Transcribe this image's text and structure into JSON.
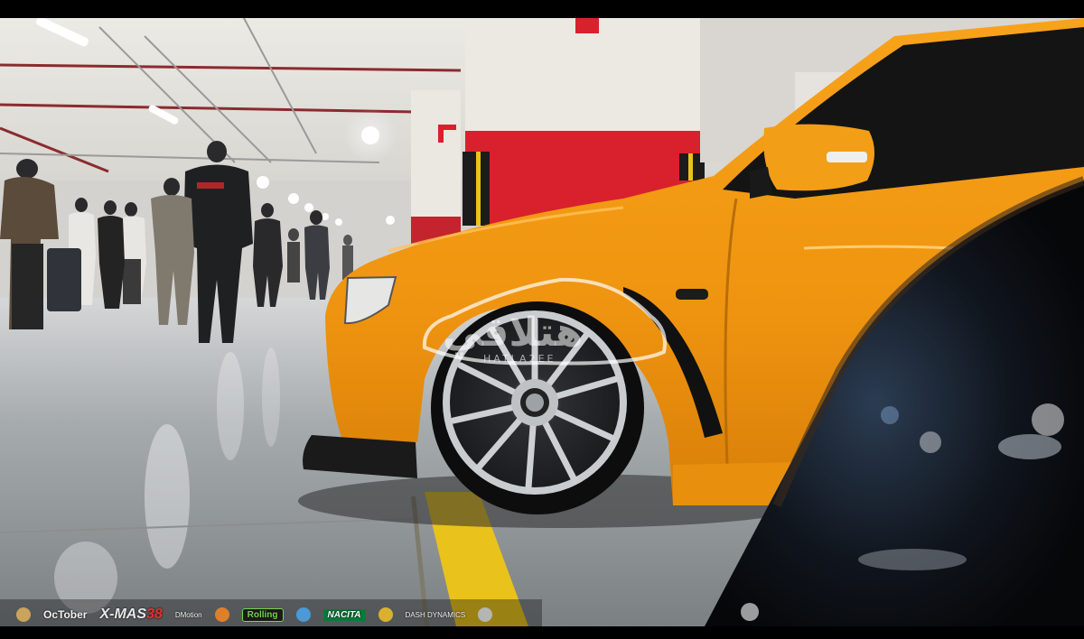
{
  "scene": {
    "description_colors": {
      "car_body": "#f29a14",
      "pillar_red": "#d8212c",
      "floor": "#9fa5a8",
      "ceiling": "#e7e4de",
      "floor_line": "#e9c21b"
    }
  },
  "watermark": {
    "brand_text": "هتلاقي",
    "sub_text": "HATLA2EE"
  },
  "sponsors": {
    "october": "OcTober",
    "xmas_main": "X-MAS",
    "xmas_num": "38",
    "dmotion": "DMotion",
    "rolling": "Rolling",
    "nacita": "NACITA",
    "dash": "DASH DYNAMICS"
  },
  "icons": [
    "car-outline-icon",
    "sponsor-logo-icon"
  ]
}
